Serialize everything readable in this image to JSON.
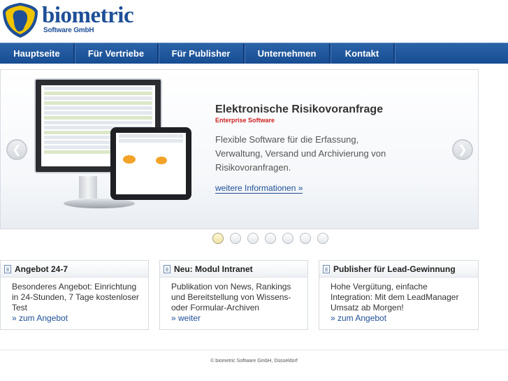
{
  "header": {
    "brand": "biometric",
    "brand_sub": "Software GmbH"
  },
  "nav": {
    "items": [
      {
        "label": "Hauptseite",
        "width": 107
      },
      {
        "label": "Für Vertriebe",
        "width": 120
      },
      {
        "label": "Für Publisher",
        "width": 123
      },
      {
        "label": "Unternehmen",
        "width": 123
      },
      {
        "label": "Kontakt",
        "width": 92
      }
    ]
  },
  "banner": {
    "title": "Elektronische Risikovoranfrage",
    "subtitle": "Enterprise Software",
    "description": "Flexible Software für die Erfassung, Verwaltung, Versand und Archivierung von Risikovoranfragen.",
    "link": "weitere Informationen »",
    "slide_count": 7,
    "active_slide": 1
  },
  "boxes": [
    {
      "title": "Angebot 24-7",
      "text": "Besonderes Angebot: Einrichtung in 24-Stunden, 7 Tage kostenloser Test",
      "link": "» zum Angebot"
    },
    {
      "title": "Neu: Modul Intranet",
      "text": "Publikation von News, Rankings und Bereitstellung von Wissens- oder Formular-Archiven",
      "link": "» weiter"
    },
    {
      "title": "Publisher für Lead-Gewinnung",
      "text": "Hohe Vergütung, einfache Integration: Mit dem LeadManager Umsatz ab Morgen!",
      "link": "» zum Angebot"
    }
  ],
  "footer": {
    "text": "© biometric Software GmbH, Düsseldorf"
  },
  "colors": {
    "brand": "#1f4f97",
    "nav": "#1f5aa0",
    "accent_red": "#cc2222"
  }
}
